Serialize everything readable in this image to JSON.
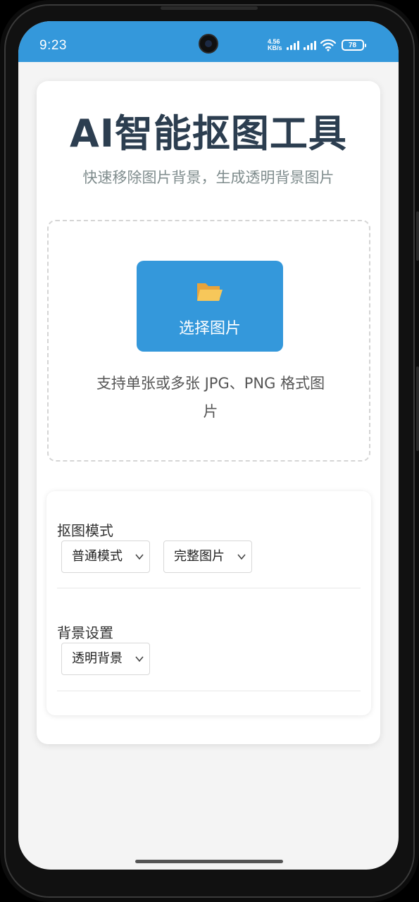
{
  "status_bar": {
    "time": "9:23",
    "net_speed_value": "4.56",
    "net_speed_unit": "KB/s",
    "battery": "78",
    "icons": [
      "signal-icon",
      "signal-icon",
      "wifi-icon",
      "battery-icon"
    ]
  },
  "app": {
    "title": "AI智能抠图工具",
    "subtitle": "快速移除图片背景，生成透明背景图片"
  },
  "upload": {
    "button_label": "选择图片",
    "button_icon": "folder-open-icon",
    "hint": "支持单张或多张 JPG、PNG 格式图片"
  },
  "settings": {
    "mode_label": "抠图模式",
    "mode_value": "普通模式",
    "scope_value": "完整图片",
    "background_label": "背景设置",
    "background_value": "透明背景"
  },
  "colors": {
    "accent": "#3498db",
    "title": "#2c3e50",
    "subtitle": "#7f8c8d"
  }
}
